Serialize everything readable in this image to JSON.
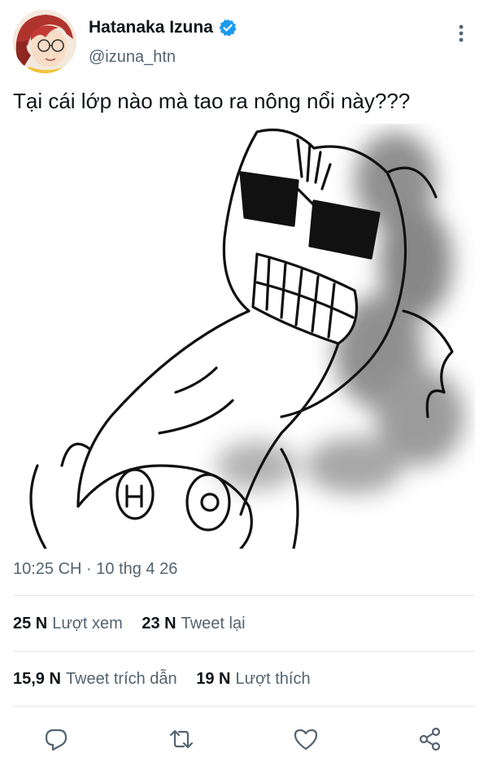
{
  "user": {
    "name": "Hatanaka Izuna",
    "handle": "@izuna_htn",
    "verified_color": "#1d9bf0"
  },
  "tweet": {
    "text": "Tại cái lớp nào mà tao ra nông nổi này???",
    "timestamp": "10:25 CH · 10 thg 4 26"
  },
  "stats": {
    "views_count": "25 N",
    "views_label": "Lượt xem",
    "retweets_count": "23 N",
    "retweets_label": "Tweet lại",
    "quotes_count": "15,9 N",
    "quotes_label": "Tweet trích dẫn",
    "likes_count": "19 N",
    "likes_label": "Lượt thích"
  },
  "actions": [
    "reply-icon",
    "retweet-icon",
    "like-icon",
    "share-icon"
  ],
  "colors": {
    "text": "#0f1419",
    "secondary": "#536471",
    "divider": "#e1e6ea"
  }
}
